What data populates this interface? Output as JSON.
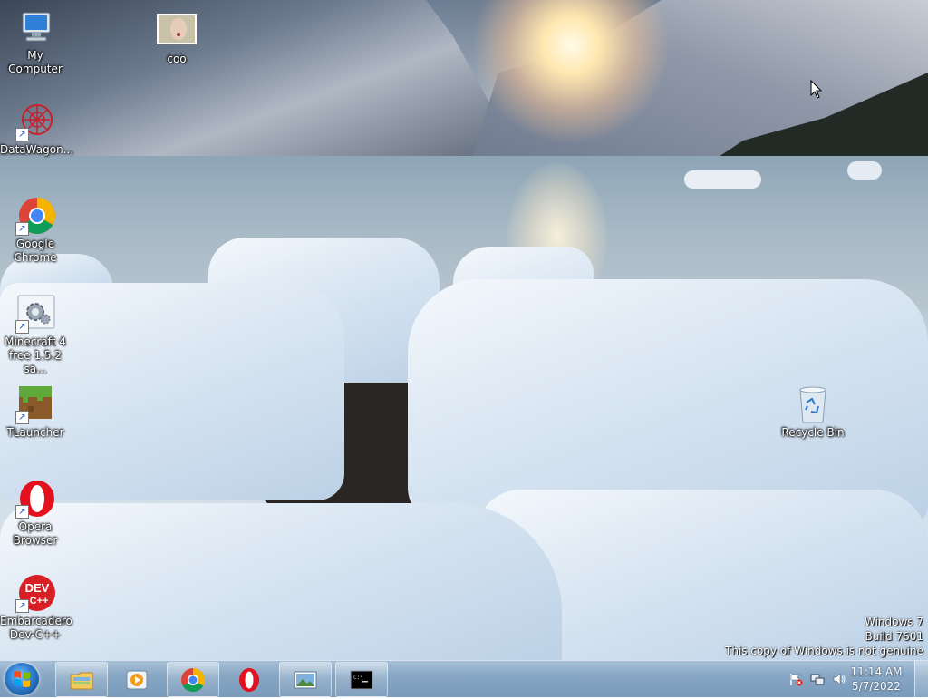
{
  "desktop": {
    "icons": [
      {
        "label": "My Computer",
        "icon": "computer-icon"
      },
      {
        "label": "coo",
        "icon": "photo-icon"
      },
      {
        "label": "DataWagon...",
        "icon": "datawagon-icon"
      },
      {
        "label": "Google Chrome",
        "icon": "chrome-icon"
      },
      {
        "label": "Minecraft 4 free 1.5.2 sa...",
        "icon": "settings-gear-icon"
      },
      {
        "label": "TLauncher",
        "icon": "grass-block-icon"
      },
      {
        "label": "Opera Browser",
        "icon": "opera-icon"
      },
      {
        "label": "Embarcadero Dev-C++",
        "icon": "devcpp-icon"
      },
      {
        "label": "Recycle Bin",
        "icon": "recycle-bin-icon"
      }
    ]
  },
  "watermark": {
    "line1": "Windows 7",
    "line2": "Build 7601",
    "line3": "This copy of Windows is not genuine"
  },
  "taskbar": {
    "items": [
      {
        "name": "windows-explorer",
        "icon": "folder-icon",
        "active": true
      },
      {
        "name": "media-player",
        "icon": "media-player-icon",
        "active": false
      },
      {
        "name": "google-chrome",
        "icon": "chrome-icon",
        "active": true
      },
      {
        "name": "opera",
        "icon": "opera-icon",
        "active": false
      },
      {
        "name": "photo-viewer",
        "icon": "picture-icon",
        "active": true
      },
      {
        "name": "command-prompt",
        "icon": "cmd-icon",
        "active": true
      }
    ],
    "clock": {
      "time": "11:14 AM",
      "date": "5/7/2022"
    }
  }
}
